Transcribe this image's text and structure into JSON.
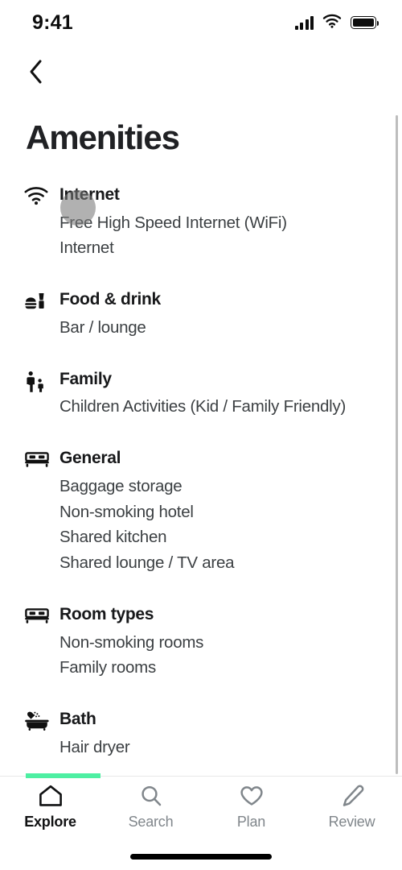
{
  "status_bar": {
    "time": "9:41",
    "signal_icon": "cellular-signal-icon",
    "wifi_icon": "wifi-icon",
    "battery_icon": "battery-full-icon"
  },
  "nav": {
    "back_icon": "chevron-left-icon",
    "back_label": "Back"
  },
  "header": {
    "title": "Amenities"
  },
  "sections": [
    {
      "icon": "wifi-icon",
      "title": "Internet",
      "items": [
        "Free High Speed Internet (WiFi)",
        "Internet"
      ]
    },
    {
      "icon": "food-drink-icon",
      "title": "Food & drink",
      "items": [
        "Bar / lounge"
      ]
    },
    {
      "icon": "family-icon",
      "title": "Family",
      "items": [
        "Children Activities (Kid / Family Friendly)"
      ]
    },
    {
      "icon": "bed-icon",
      "title": "General",
      "items": [
        "Baggage storage",
        "Non-smoking hotel",
        "Shared kitchen",
        "Shared lounge / TV area"
      ]
    },
    {
      "icon": "bed-icon",
      "title": "Room types",
      "items": [
        "Non-smoking rooms",
        "Family rooms"
      ]
    },
    {
      "icon": "bathtub-icon",
      "title": "Bath",
      "items": [
        "Hair dryer"
      ]
    }
  ],
  "tab_bar": {
    "accent_color": "#4DEFA2",
    "active_index": 0,
    "tabs": [
      {
        "label": "Explore",
        "icon": "home-icon"
      },
      {
        "label": "Search",
        "icon": "search-icon"
      },
      {
        "label": "Plan",
        "icon": "heart-icon"
      },
      {
        "label": "Review",
        "icon": "pencil-icon"
      }
    ]
  },
  "overlays": {
    "tap_indicator": "tap-indicator"
  }
}
